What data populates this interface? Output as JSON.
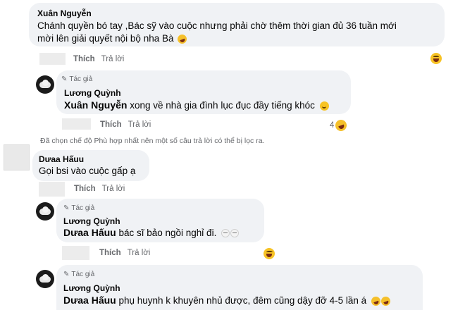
{
  "comments": [
    {
      "author": "Xuân Nguyễn",
      "text": "Chánh quyền bó tay ,Bác sỹ vào cuộc nhưng phải chờ thêm thời gian đủ 36 tuần mới",
      "text_line2": "mời lên giải quyết nội bộ nha Bà",
      "like_label": "Thích",
      "reply_label": "Trả lời"
    },
    {
      "author": "Dưaa Hấuu",
      "text": "Gọi bsi vào cuộc gấp ạ",
      "like_label": "Thích",
      "reply_label": "Trả lời"
    }
  ],
  "replies": [
    {
      "author_tag": "Tác giả",
      "author": "Lương Quỳnh",
      "mention": "Xuân Nguyễn",
      "text": " xong về nhà gia đình lục đục đầy tiếng khóc",
      "like_label": "Thích",
      "reply_label": "Trả lời",
      "reaction_count": "4"
    },
    {
      "author_tag": "Tác giả",
      "author": "Lương Quỳnh",
      "mention": "Dưaa Hấuu",
      "text": " bác sĩ bảo ngồi nghỉ đi.",
      "like_label": "Thích",
      "reply_label": "Trả lời"
    },
    {
      "author_tag": "Tác giả",
      "author": "Lương Quỳnh",
      "mention": "Dưaa Hấuu",
      "text": " phụ huynh k khuyên nhủ được, đêm cũng dậy đỡ 4-5 lần á"
    }
  ],
  "filter_notice": "Đã chọn chế độ Phù hợp nhất nên một số câu trả lời có thể bị lọc ra.",
  "icons": {
    "pen": "pencil-icon",
    "laugh": "laughing-emoji",
    "smile": "smiling-emoji",
    "rofl": "rolling-laughing-emoji",
    "grimace": "grimacing-emoji"
  }
}
